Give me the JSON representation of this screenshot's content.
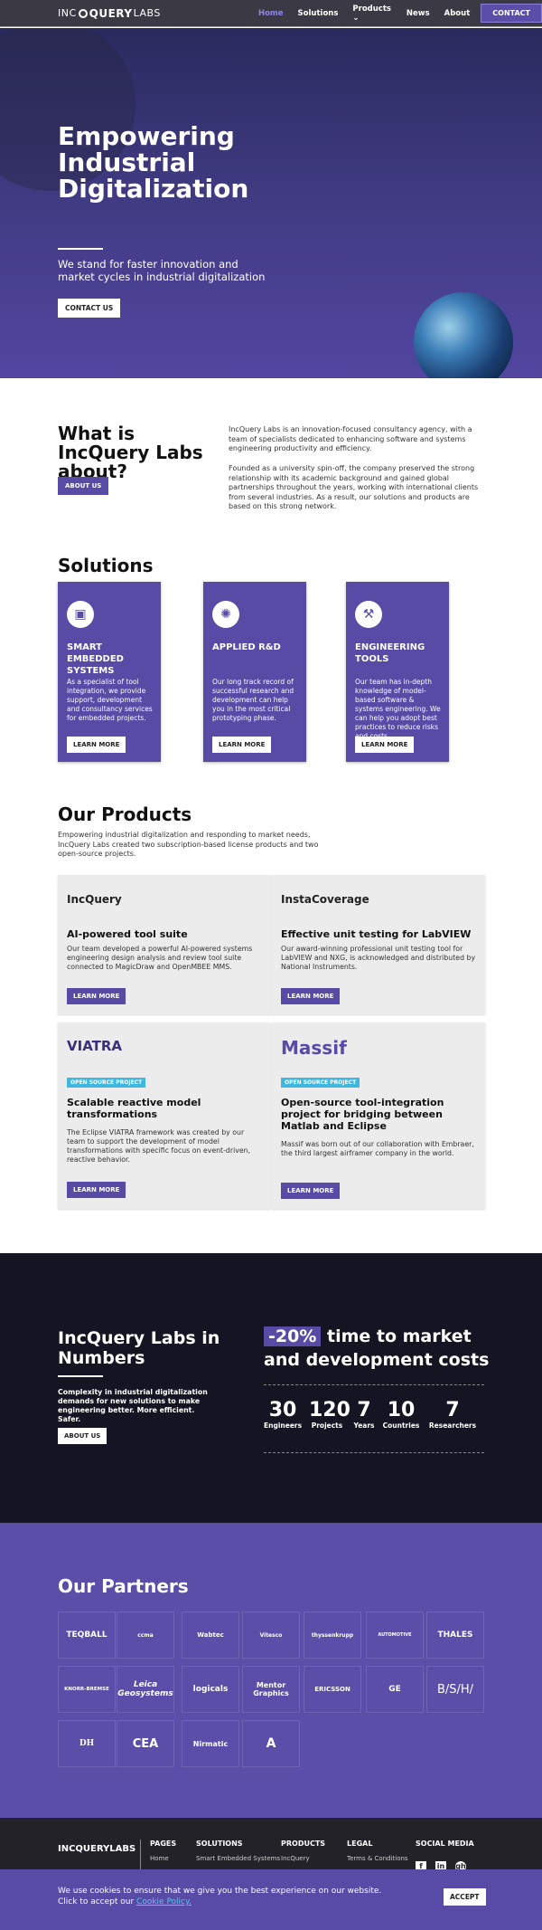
{
  "nav": {
    "logo_pre": "INC",
    "logo_mid": "QUERY",
    "logo_post": "LABS",
    "items": [
      "Home",
      "Solutions",
      "Products ⌄",
      "News",
      "About"
    ],
    "contact": "CONTACT",
    "active_color": "#8e85e6"
  },
  "hero": {
    "title": "Empowering Industrial Digitalization",
    "subtitle": "We stand for faster innovation and market cycles in industrial digitalization",
    "button": "CONTACT US",
    "scroll_icon": "chevron-down-icon"
  },
  "about": {
    "heading": "What is IncQuery Labs about?",
    "button": "ABOUT US",
    "p1": "IncQuery Labs is an innovation-focused consultancy agency, with a team of specialists dedicated to enhancing software and systems engineering productivity and efficiency.",
    "p2": "Founded as a university spin-off, the company preserved the strong relationship with its academic background and gained global partnerships throughout the years, working with international clients from several industries. As a result, our solutions and products are based on this strong network."
  },
  "solutions": {
    "heading": "Solutions",
    "cards": [
      {
        "icon": "chip-icon",
        "glyph": "▣",
        "title": "SMART EMBEDDED SYSTEMS",
        "text": "As a specialist of tool integration, we provide support, development and consultancy services for embedded projects.",
        "button": "LEARN MORE"
      },
      {
        "icon": "brain-icon",
        "glyph": "✺",
        "title": "APPLIED  R&D",
        "text": "Our long track record of successful research and development can help you in the most critical prototyping phase.",
        "button": "LEARN MORE"
      },
      {
        "icon": "wrench-icon",
        "glyph": "⚒",
        "title": "ENGINEERING TOOLS",
        "text": "Our team has in-depth knowledge of model-based software & systems engineering. We can help you adopt best practices to reduce risks and costs.",
        "button": "LEARN MORE"
      }
    ]
  },
  "products": {
    "heading": "Our Products",
    "intro": "Empowering industrial digitalization and responding to market needs, IncQuery Labs created two subscription-based license products and two open-source projects.",
    "items": [
      {
        "logo": "IncQuery",
        "title": "AI-powered tool suite",
        "text": "Our team developed a powerful AI-powered systems engineering design analysis and review tool suite connected to MagicDraw and OpenMBEE MMS.",
        "button": "LEARN MORE"
      },
      {
        "logo": "InstaCoverage",
        "title": "Effective unit testing for LabVIEW",
        "text": "Our award-winning professional unit testing tool for LabVIEW and NXG, is acknowledged and distributed by National Instruments.",
        "button": "LEARN MORE"
      },
      {
        "logo": "VIATRA",
        "tag": "OPEN SOURCE PROJECT",
        "title": "Scalable reactive model transformations",
        "text": "The Eclipse VIATRA framework was created by our team to support the development of model transformations with specific focus on event-driven, reactive behavior.",
        "button": "LEARN MORE"
      },
      {
        "logo": "Massif",
        "tag": "OPEN SOURCE PROJECT",
        "title": "Open-source tool-integration project for bridging between Matlab and Eclipse",
        "text": "Massif was born out of our collaboration with Embraer, the third largest airframer company in the world.",
        "button": "LEARN MORE"
      }
    ]
  },
  "numbers": {
    "heading": "IncQuery Labs in Numbers",
    "text": "Complexity in industrial digitalization demands for new solutions to make engineering better. More efficient. Safer.",
    "button": "ABOUT US",
    "highlight": "-20%",
    "headline_rest": " time to market and development costs",
    "stats": [
      {
        "value": "30",
        "label": "Engineers"
      },
      {
        "value": "120",
        "label": "Projects"
      },
      {
        "value": "7",
        "label": "Years"
      },
      {
        "value": "10",
        "label": "Countries"
      },
      {
        "value": "7",
        "label": "Researchers"
      }
    ]
  },
  "partners": {
    "heading": "Our Partners",
    "logos": [
      "TEQBALL",
      "ccma",
      "Wabtec",
      "Vitesco",
      "thyssenkrupp",
      "AUTOMOTIVE",
      "THALES",
      "KNORR-BREMSE",
      "Leica Geosystems",
      "logicals",
      "Mentor Graphics",
      "ERICSSON",
      "GE",
      "B/S/H/",
      "DH",
      "CEA",
      "Nirmatic",
      "A"
    ]
  },
  "footer": {
    "logo": "INCQUERYLABS",
    "columns": [
      {
        "heading": "PAGES",
        "item": "Home"
      },
      {
        "heading": "SOLUTIONS",
        "item": "Smart Embedded Systems"
      },
      {
        "heading": "PRODUCTS",
        "item": "IncQuery"
      },
      {
        "heading": "LEGAL",
        "item": "Terms & Conditions"
      },
      {
        "heading": "SOCIAL MEDIA",
        "item": ""
      }
    ],
    "social": [
      "f",
      "in",
      "gh"
    ]
  },
  "cookie": {
    "text": "We use cookies to ensure that we give you the best experience on our website. Click to accept our ",
    "link": "Cookie Policy.",
    "button": "ACCEPT"
  }
}
